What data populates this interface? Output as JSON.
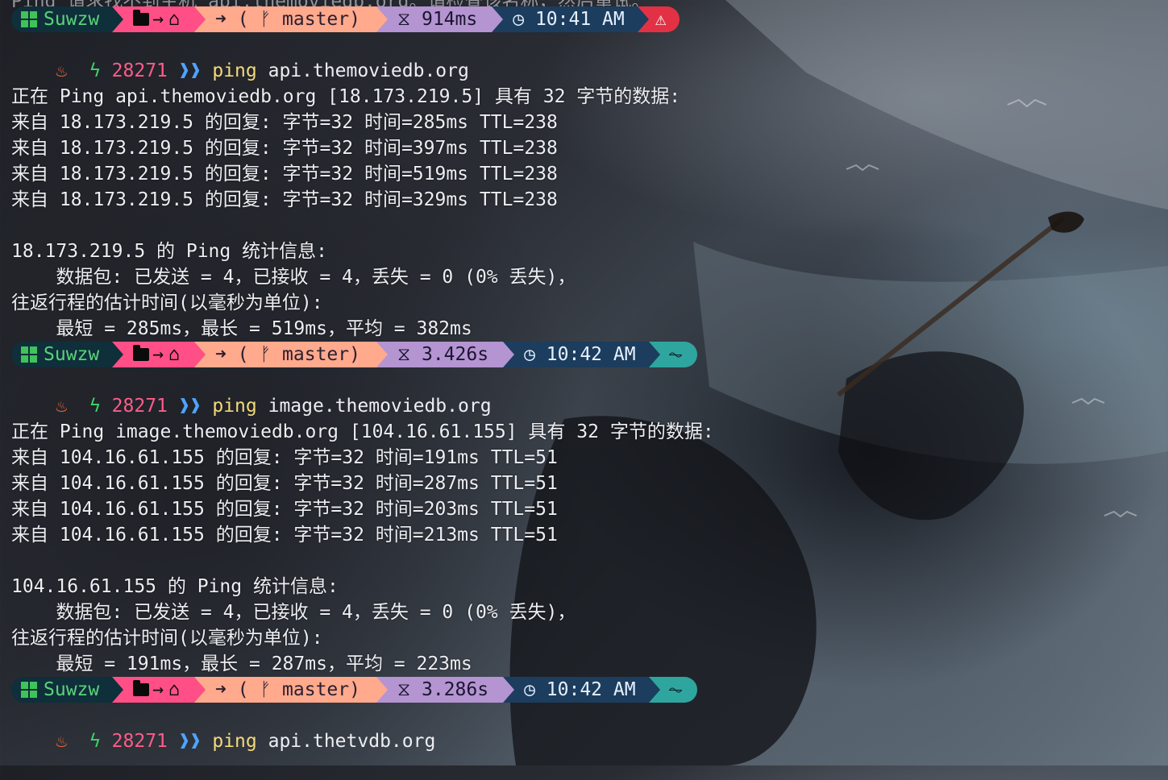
{
  "prompt_common": {
    "user": "Suwzw",
    "path_arrow": "→",
    "git_arrow": "➜",
    "git_branch": "( ᚠ master)",
    "pid": "28271",
    "chevrons": "❱❱"
  },
  "top_clipped_text": "Ping 请求找不到主机 api.themoviedb.org。请检查该名称，然后重试。",
  "prompts": [
    {
      "duration": "914ms",
      "time": "10:41 AM",
      "status_icon": "⚠",
      "cmd": "ping",
      "arg": "api.themoviedb.org"
    },
    {
      "duration": "3.426s",
      "time": "10:42 AM",
      "status_icon": "⏦",
      "cmd": "ping",
      "arg": "image.themoviedb.org"
    },
    {
      "duration": "3.286s",
      "time": "10:42 AM",
      "status_icon": "⏦",
      "cmd": "ping",
      "arg": "api.thetvdb.org"
    }
  ],
  "output_block_1": [
    "",
    "正在 Ping api.themoviedb.org [18.173.219.5] 具有 32 字节的数据:",
    "来自 18.173.219.5 的回复: 字节=32 时间=285ms TTL=238",
    "来自 18.173.219.5 的回复: 字节=32 时间=397ms TTL=238",
    "来自 18.173.219.5 的回复: 字节=32 时间=519ms TTL=238",
    "来自 18.173.219.5 的回复: 字节=32 时间=329ms TTL=238",
    "",
    "18.173.219.5 的 Ping 统计信息:",
    "    数据包: 已发送 = 4，已接收 = 4，丢失 = 0 (0% 丢失)，",
    "往返行程的估计时间(以毫秒为单位):",
    "    最短 = 285ms，最长 = 519ms，平均 = 382ms"
  ],
  "output_block_2": [
    "",
    "正在 Ping image.themoviedb.org [104.16.61.155] 具有 32 字节的数据:",
    "来自 104.16.61.155 的回复: 字节=32 时间=191ms TTL=51",
    "来自 104.16.61.155 的回复: 字节=32 时间=287ms TTL=51",
    "来自 104.16.61.155 的回复: 字节=32 时间=203ms TTL=51",
    "来自 104.16.61.155 的回复: 字节=32 时间=213ms TTL=51",
    "",
    "104.16.61.155 的 Ping 统计信息:",
    "    数据包: 已发送 = 4，已接收 = 4，丢失 = 0 (0% 丢失)，",
    "往返行程的估计时间(以毫秒为单位):",
    "    最短 = 191ms，最长 = 287ms，平均 = 223ms"
  ]
}
